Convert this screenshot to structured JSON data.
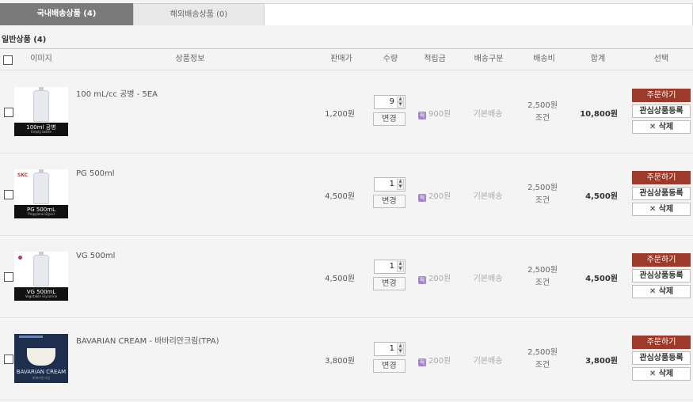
{
  "tabs": {
    "domestic": "국내배송상품 (4)",
    "overseas": "해외배송상품 (0)"
  },
  "section_title": "일반상품 (4)",
  "columns": {
    "image": "이미지",
    "info": "상품정보",
    "price": "판매가",
    "qty": "수량",
    "points": "적립금",
    "ship_type": "배송구분",
    "ship_fee": "배송비",
    "total": "합계",
    "select": "선택"
  },
  "labels": {
    "change": "변경",
    "order": "주문하기",
    "wishlist": "관심상품등록",
    "delete": "삭제",
    "delete_icon": "✕",
    "point_icon": "적",
    "spin_up": "▲",
    "spin_down": "▼"
  },
  "items": [
    {
      "name": "100 mL/cc 공병 - 5EA",
      "thumb_title": "100ml 공병",
      "thumb_sub": "Empty bottle",
      "price": "1,200원",
      "qty": "9",
      "points": "900원",
      "ship_type": "기본배송",
      "ship_fee": "2,500원",
      "ship_cond": "조건",
      "total": "10,800원"
    },
    {
      "name": "PG 500ml",
      "thumb_brand": "SKC",
      "thumb_title": "PG 500mL",
      "thumb_sub": "Propylene Glycol",
      "price": "4,500원",
      "qty": "1",
      "points": "200원",
      "ship_type": "기본배송",
      "ship_fee": "2,500원",
      "ship_cond": "조건",
      "total": "4,500원"
    },
    {
      "name": "VG 500ml",
      "thumb_title": "VG 500mL",
      "thumb_sub": "Vegetable Glycerine",
      "price": "4,500원",
      "qty": "1",
      "points": "200원",
      "ship_type": "기본배송",
      "ship_fee": "2,500원",
      "ship_cond": "조건",
      "total": "4,500원"
    },
    {
      "name": "BAVARIAN CREAM - 바바리안크림(TPA)",
      "thumb_title": "BAVARIAN CREAM",
      "thumb_sub": "바바리안크림",
      "price": "3,800원",
      "qty": "1",
      "points": "200원",
      "ship_type": "기본배송",
      "ship_fee": "2,500원",
      "ship_cond": "조건",
      "total": "3,800원"
    }
  ]
}
